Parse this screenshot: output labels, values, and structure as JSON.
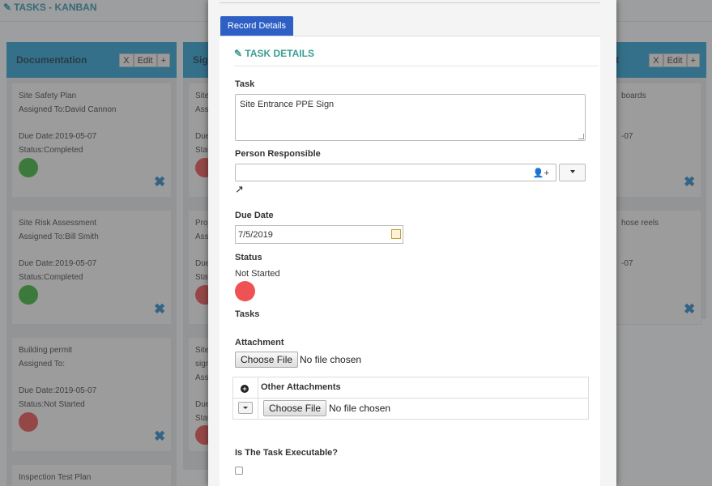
{
  "page": {
    "title": "TASKS - KANBAN"
  },
  "columns": [
    {
      "name": "Documentation",
      "btn_x": "X",
      "btn_edit": "Edit",
      "btn_add": "+",
      "cards": [
        {
          "title": "Site Safety Plan",
          "assigned": "Assigned To:David Cannon",
          "due": "Due Date:2019-05-07",
          "status": "Status:Completed"
        },
        {
          "title": "Site Risk Assessment",
          "assigned": "Assigned To:Bill Smith",
          "due": "Due Date:2019-05-07",
          "status": "Status:Completed"
        },
        {
          "title": "Building permit",
          "assigned": "Assigned To:",
          "due": "Due Date:2019-05-07",
          "status": "Status:Not Started"
        },
        {
          "title": "Inspection Test Plan"
        }
      ]
    },
    {
      "name": "Sig",
      "cards": [
        {
          "title": "Site",
          "assigned": "Ass",
          "due": "Due",
          "status": "Stat"
        },
        {
          "title": "Proj",
          "assigned": "Ass",
          "due": "Due",
          "status": "Stat"
        },
        {
          "title": "Site",
          "title2": "sign",
          "assigned": "Ass",
          "due": "Due",
          "status": "Stat"
        }
      ]
    },
    {
      "name": "t",
      "btn_x": "X",
      "btn_edit": "Edit",
      "btn_add": "+",
      "cards": [
        {
          "title": "boards",
          "due": "-07"
        },
        {
          "title": "hose reels",
          "due": "-07"
        }
      ]
    }
  ],
  "modal": {
    "tab": "Record Details",
    "section_title": "TASK DETAILS",
    "task_label": "Task",
    "task_value": "Site Entrance PPE Sign",
    "person_label": "Person Responsible",
    "due_label": "Due Date",
    "due_value": "7/5/2019",
    "status_label": "Status",
    "status_value": "Not Started",
    "tasks_label": "Tasks",
    "attachment_label": "Attachment",
    "choose_file": "Choose File",
    "no_file": "No file chosen",
    "other_attachments": "Other Attachments",
    "executable_label": "Is The Task Executable?"
  },
  "colors": {
    "column_header": "#2e9cc8",
    "completed": "#3cae3c",
    "not_started": "#df5050",
    "tab": "#2e5fc5",
    "section_title": "#3a9e93"
  },
  "icons": [
    "edit-icon",
    "user-add-icon",
    "external-link-icon",
    "calendar-icon",
    "plus-circle-icon",
    "delete-icon"
  ]
}
